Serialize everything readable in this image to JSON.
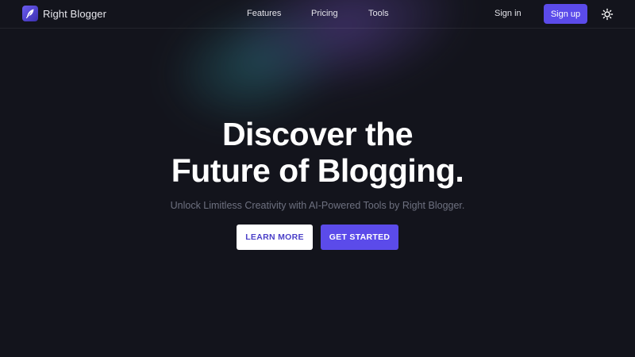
{
  "brand": {
    "name": "Right Blogger",
    "logo_icon": "feather-icon"
  },
  "nav": {
    "links": [
      {
        "label": "Features"
      },
      {
        "label": "Pricing"
      },
      {
        "label": "Tools"
      }
    ],
    "signin_label": "Sign in",
    "signup_label": "Sign up",
    "theme_toggle_icon": "sun-icon"
  },
  "hero": {
    "title_line1": "Discover the",
    "title_line2": "Future of Blogging.",
    "subtitle": "Unlock Limitless Creativity with AI-Powered Tools by Right Blogger.",
    "learn_more_label": "LEARN MORE",
    "get_started_label": "GET STARTED"
  },
  "colors": {
    "background": "#13141c",
    "accent": "#5b4bea",
    "subtitle_text": "#6e7180"
  }
}
